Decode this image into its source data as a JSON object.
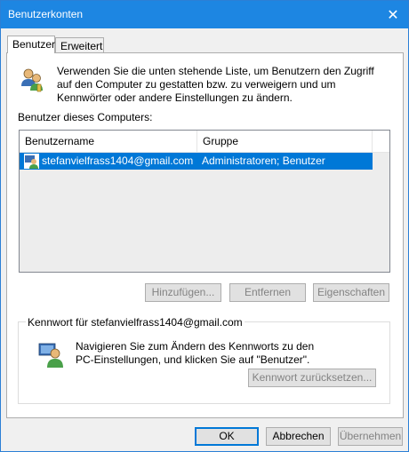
{
  "window": {
    "title": "Benutzerkonten",
    "close_glyph": "✕"
  },
  "tabs": [
    {
      "label": "Benutzer",
      "active": true
    },
    {
      "label": "Erweitert",
      "active": false
    }
  ],
  "intro_text": "Verwenden Sie die unten stehende Liste, um Benutzern den Zugriff auf den Computer zu gestatten bzw. zu verweigern und um Kennwörter oder andere Einstellungen zu ändern.",
  "users_heading": "Benutzer dieses Computers:",
  "table": {
    "columns": [
      "Benutzername",
      "Gruppe"
    ],
    "rows": [
      {
        "username": "stefanvielfrass1404@gmail.com",
        "group": "Administratoren; Benutzer",
        "selected": true
      }
    ]
  },
  "buttons": {
    "add": "Hinzufügen...",
    "remove": "Entfernen",
    "properties": "Eigenschaften",
    "reset_password": "Kennwort zurücksetzen...",
    "ok": "OK",
    "cancel": "Abbrechen",
    "apply": "Übernehmen"
  },
  "password_group": {
    "title": "Kennwort für stefanvielfrass1404@gmail.com",
    "text": "Navigieren Sie zum Ändern des Kennworts zu den PC-Einstellungen, und klicken Sie auf \"Benutzer\"."
  },
  "colors": {
    "titlebar": "#1d86e2",
    "selection": "#0078d7"
  },
  "icons": [
    "users-icon",
    "user-row-icon",
    "user-password-icon",
    "close-icon"
  ]
}
